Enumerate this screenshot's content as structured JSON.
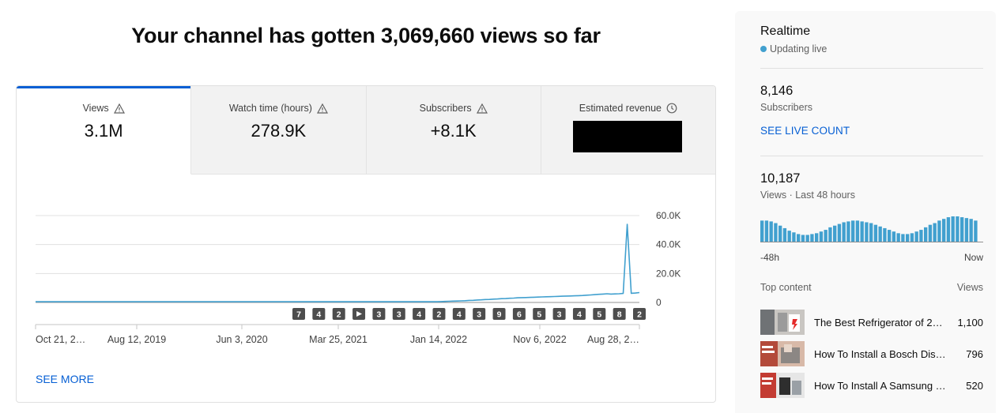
{
  "headline": "Your channel has gotten 3,069,660 views so far",
  "tabs": [
    {
      "label": "Views",
      "value": "3.1M",
      "icon": "warning-icon"
    },
    {
      "label": "Watch time (hours)",
      "value": "278.9K",
      "icon": "warning-icon"
    },
    {
      "label": "Subscribers",
      "value": "+8.1K",
      "icon": "warning-icon"
    },
    {
      "label": "Estimated revenue",
      "value": "",
      "icon": "clock-icon"
    }
  ],
  "chart_data": {
    "type": "line",
    "series": [
      {
        "values": [
          500,
          500,
          500,
          500,
          500,
          500,
          500,
          500,
          500,
          500,
          500,
          500,
          500,
          500,
          500,
          500,
          500,
          500,
          500,
          500,
          500,
          500,
          500,
          500,
          500,
          500,
          500,
          500,
          500,
          500,
          500,
          500,
          500,
          500,
          500,
          500,
          500,
          500,
          500,
          500,
          500,
          500,
          500,
          500,
          500,
          500,
          500,
          500,
          500,
          500,
          500,
          500,
          500,
          500,
          500,
          500,
          500,
          500,
          500,
          500,
          500,
          500,
          500,
          500,
          500,
          500,
          500,
          500,
          500,
          500,
          500,
          500,
          500,
          500,
          500,
          500,
          500,
          500,
          500,
          500,
          500,
          500,
          500,
          500,
          500,
          500,
          500,
          500,
          500,
          500,
          500,
          500,
          500,
          500,
          500,
          500,
          500,
          500,
          500,
          500,
          600,
          700,
          800,
          900,
          1000,
          1100,
          1200,
          1400,
          1500,
          1700,
          1800,
          2000,
          2100,
          2300,
          2400,
          2600,
          2700,
          2900,
          3000,
          3200,
          3300,
          3400,
          3500,
          3600,
          3700,
          3800,
          3900,
          4000,
          4100,
          4200,
          4300,
          4400,
          4500,
          4600,
          4700,
          4800,
          5000,
          5200,
          5400,
          5600,
          5800,
          6000,
          5800,
          5900,
          6000,
          6200,
          54000,
          6300,
          6500,
          6800
        ]
      }
    ],
    "x_tick_labels": [
      "Oct 21, 2…",
      "Aug 12, 2019",
      "Jun 3, 2020",
      "Mar 25, 2021",
      "Jan 14, 2022",
      "Nov 6, 2022",
      "Aug 28, 2…"
    ],
    "y_tick_labels": [
      "60.0K",
      "40.0K",
      "20.0K",
      "0"
    ],
    "ylim": [
      0,
      60000
    ],
    "grid": true,
    "series_color": "#41a0cf",
    "markers": [
      "7",
      "4",
      "2",
      "play",
      "3",
      "3",
      "4",
      "2",
      "4",
      "3",
      "9",
      "6",
      "5",
      "3",
      "4",
      "5",
      "8",
      "2"
    ]
  },
  "see_more": "SEE MORE",
  "realtime": {
    "title": "Realtime",
    "status": "Updating live",
    "subscribers_count": "8,146",
    "subscribers_label": "Subscribers",
    "see_live_count": "SEE LIVE COUNT",
    "views_count": "10,187",
    "views_label": "Views · Last 48 hours",
    "hourly_views": [
      250,
      250,
      240,
      220,
      190,
      160,
      130,
      110,
      90,
      80,
      80,
      90,
      100,
      120,
      140,
      170,
      190,
      210,
      230,
      240,
      250,
      250,
      240,
      230,
      220,
      200,
      180,
      160,
      140,
      120,
      100,
      90,
      90,
      100,
      120,
      140,
      170,
      200,
      220,
      250,
      270,
      290,
      300,
      300,
      290,
      280,
      270,
      250
    ],
    "axis_left": "-48h",
    "axis_right": "Now",
    "top_content_label": "Top content",
    "views_col_label": "Views",
    "top_content": [
      {
        "title": "The Best Refrigerator of 2…",
        "views": "1,100"
      },
      {
        "title": "How To Install a Bosch Dis…",
        "views": "796"
      },
      {
        "title": "How To Install A Samsung …",
        "views": "520"
      }
    ]
  },
  "colors": {
    "accent": "#065fd4",
    "series": "#41a0cf",
    "live": "#41a0cf"
  }
}
